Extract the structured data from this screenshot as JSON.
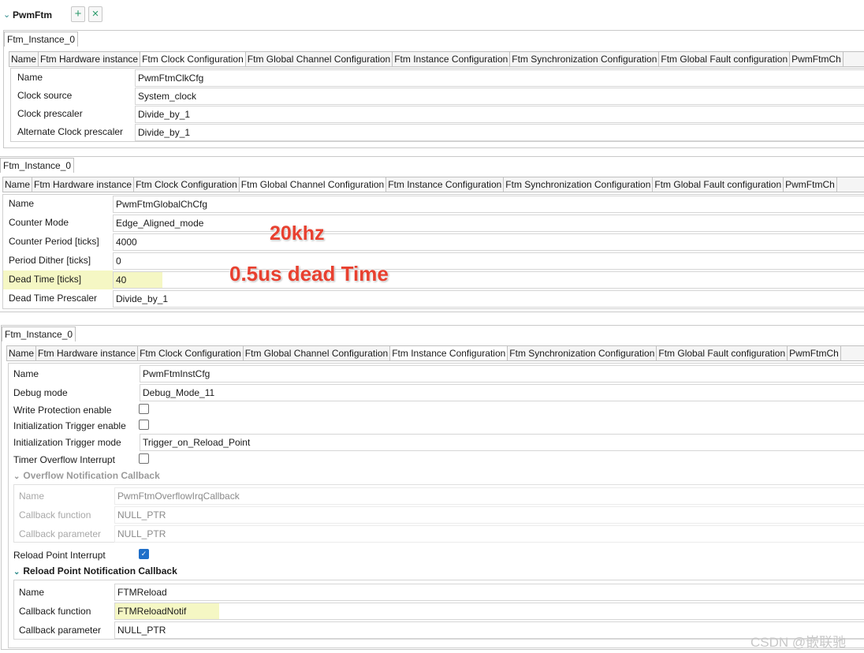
{
  "header": {
    "title": "PwmFtm",
    "expand_glyph": "⌄",
    "add_glyph": "+",
    "remove_glyph": "×"
  },
  "tabs": [
    "Name",
    "Ftm Hardware instance",
    "Ftm Clock Configuration",
    "Ftm Global Channel Configuration",
    "Ftm Instance Configuration",
    "Ftm Synchronization Configuration",
    "Ftm Global Fault configuration",
    "PwmFtmCh"
  ],
  "clock_panel": {
    "instance_tab": "Ftm_Instance_0",
    "selected_tab": 2,
    "rows": [
      {
        "label": "Name",
        "value": "PwmFtmClkCfg"
      },
      {
        "label": "Clock source",
        "value": "System_clock"
      },
      {
        "label": "Clock prescaler",
        "value": "Divide_by_1"
      },
      {
        "label": "Alternate Clock prescaler",
        "value": "Divide_by_1"
      }
    ]
  },
  "global_panel": {
    "instance_tab": "Ftm_Instance_0",
    "selected_tab": 3,
    "rows": [
      {
        "label": "Name",
        "value": "PwmFtmGlobalChCfg"
      },
      {
        "label": "Counter Mode",
        "value": "Edge_Aligned_mode"
      },
      {
        "label": "Counter Period [ticks]",
        "value": "4000"
      },
      {
        "label": "Period Dither [ticks]",
        "value": "0"
      },
      {
        "label": "Dead Time [ticks]",
        "value": "40"
      },
      {
        "label": "Dead Time Prescaler",
        "value": "Divide_by_1"
      }
    ],
    "highlight_color": "#f5f7c4"
  },
  "annotations": {
    "frequency": "20khz",
    "dead_time": "0.5us dead Time",
    "color": "#e8402f"
  },
  "instance_panel": {
    "instance_tab": "Ftm_Instance_0",
    "selected_tab": 4,
    "name": {
      "label": "Name",
      "value": "PwmFtmInstCfg"
    },
    "debug": {
      "label": "Debug mode",
      "value": "Debug_Mode_11"
    },
    "write_protection": {
      "label": "Write Protection enable",
      "checked": false
    },
    "init_trigger": {
      "label": "Initialization Trigger enable",
      "checked": false
    },
    "init_trigger_mode": {
      "label": "Initialization Trigger mode",
      "value": "Trigger_on_Reload_Point"
    },
    "timer_overflow": {
      "label": "Timer Overflow Interrupt",
      "checked": false
    },
    "overflow_cb": {
      "title": "Overflow Notification Callback",
      "rows": [
        {
          "label": "Name",
          "value": "PwmFtmOverflowIrqCallback"
        },
        {
          "label": "Callback function",
          "value": "NULL_PTR"
        },
        {
          "label": "Callback parameter",
          "value": "NULL_PTR"
        }
      ]
    },
    "reload_interrupt": {
      "label": "Reload Point Interrupt",
      "checked": true,
      "check_glyph": "✓"
    },
    "reload_cb": {
      "title": "Reload Point Notification Callback",
      "rows": [
        {
          "label": "Name",
          "value": "FTMReload"
        },
        {
          "label": "Callback function",
          "value": "FTMReloadNotif"
        },
        {
          "label": "Callback parameter",
          "value": "NULL_PTR"
        }
      ]
    }
  },
  "watermark": "CSDN @嵌联驰"
}
